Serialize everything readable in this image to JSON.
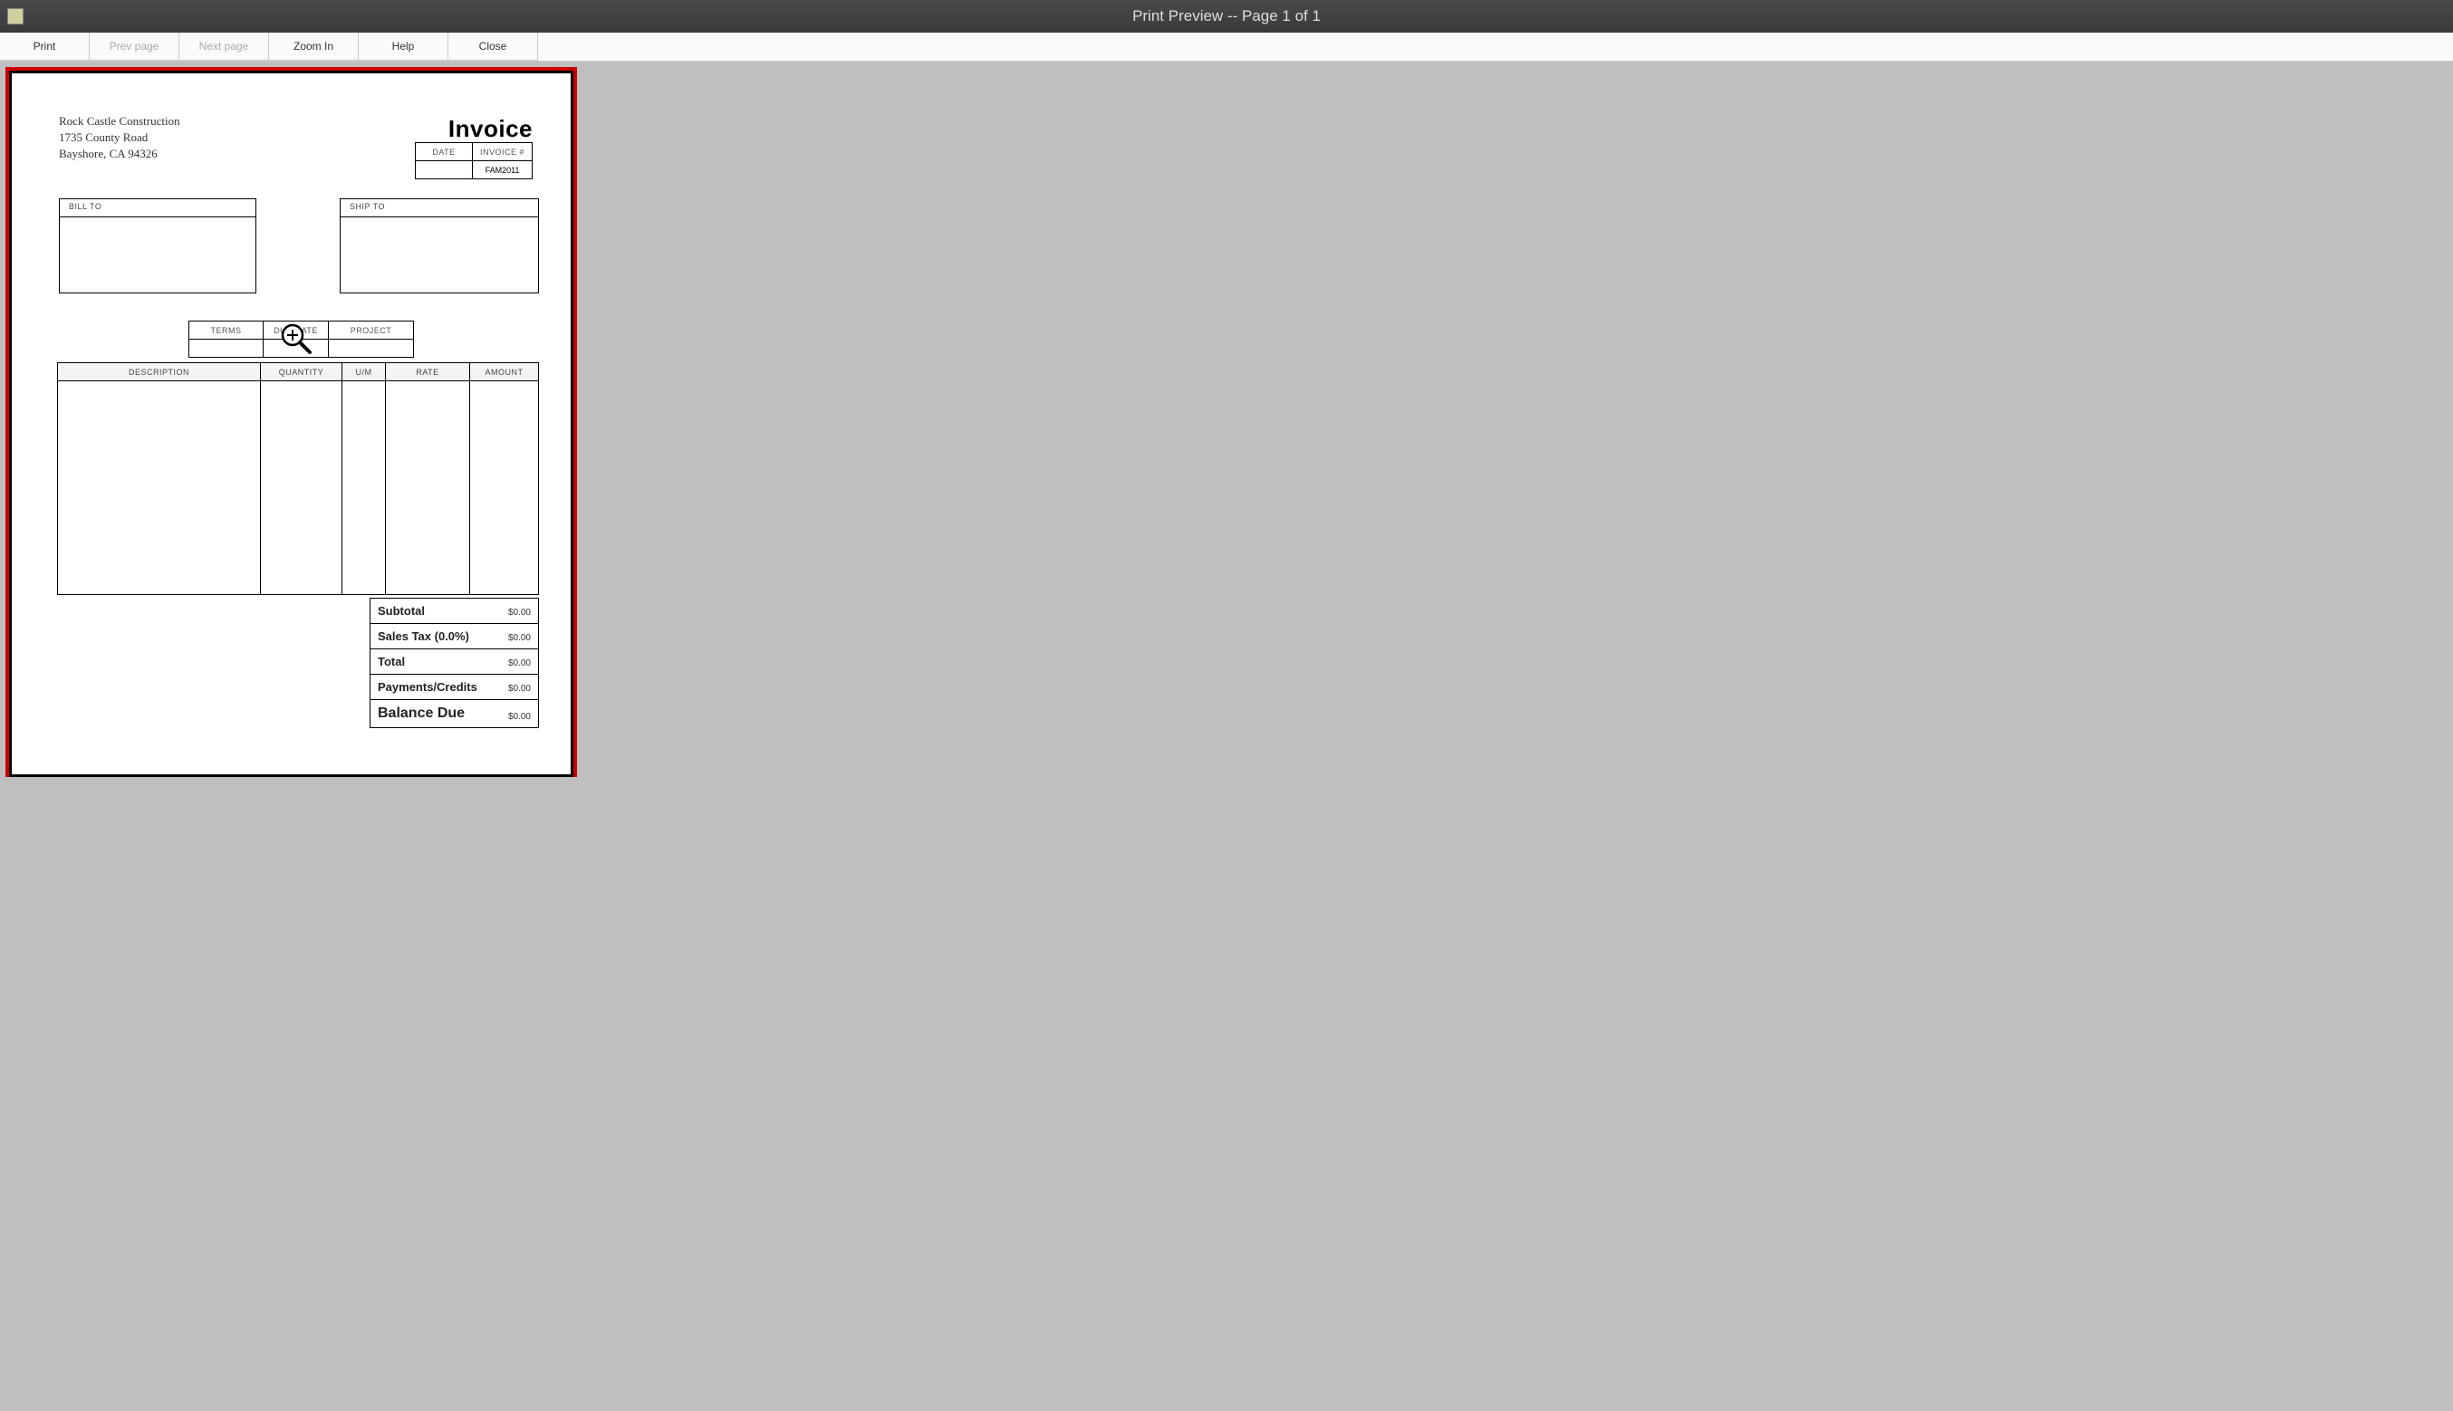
{
  "window": {
    "title": "Print Preview -- Page 1 of 1"
  },
  "toolbar": {
    "print": "Print",
    "prev_page": "Prev page",
    "next_page": "Next page",
    "zoom_in": "Zoom In",
    "help": "Help",
    "close": "Close"
  },
  "invoice": {
    "company": {
      "name": "Rock Castle Construction",
      "street": "1735 County Road",
      "city_state_zip": "Bayshore, CA 94326"
    },
    "title": "Invoice",
    "date_label": "DATE",
    "invoice_num_label": "INVOICE #",
    "date_value": "",
    "invoice_num_value": "FAM2011",
    "bill_to_label": "BILL TO",
    "ship_to_label": "SHIP TO",
    "terms_label": "TERMS",
    "due_date_label": "DUE DATE",
    "project_label": "PROJECT",
    "columns": {
      "description": "DESCRIPTION",
      "quantity": "QUANTITY",
      "um": "U/M",
      "rate": "RATE",
      "amount": "AMOUNT"
    },
    "totals": {
      "subtotal_label": "Subtotal",
      "subtotal_value": "$0.00",
      "sales_tax_label": "Sales Tax  (0.0%)",
      "sales_tax_value": "$0.00",
      "total_label": "Total",
      "total_value": "$0.00",
      "payments_label": "Payments/Credits",
      "payments_value": "$0.00",
      "balance_label": "Balance Due",
      "balance_value": "$0.00"
    }
  }
}
